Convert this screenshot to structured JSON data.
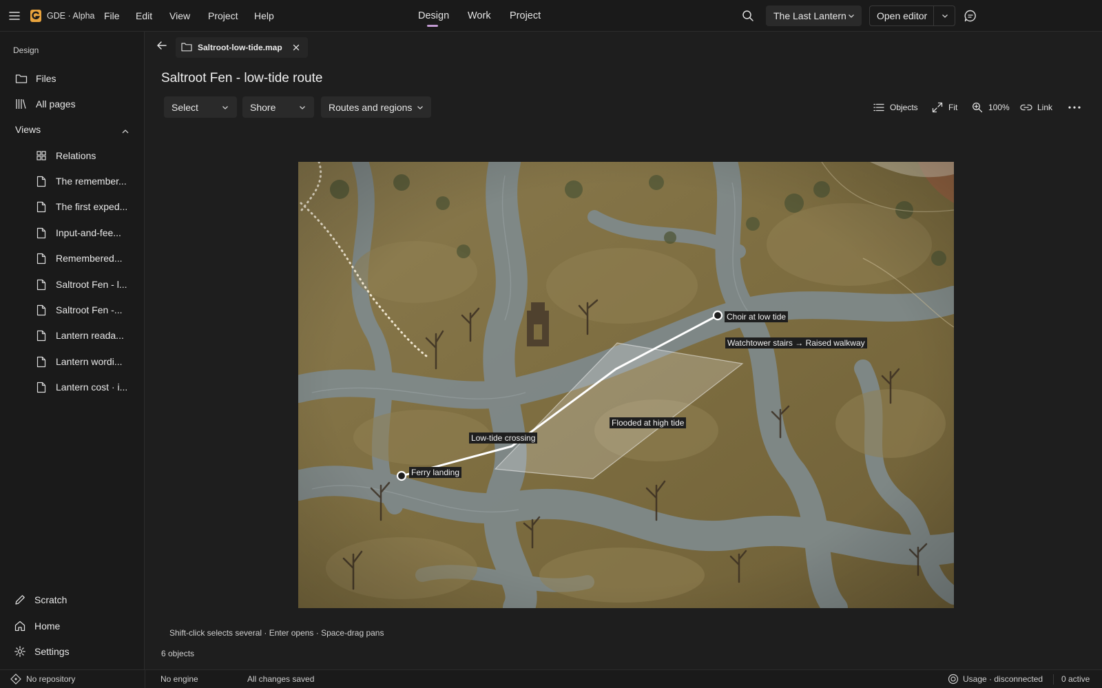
{
  "app": {
    "name": "GDE · Alpha"
  },
  "menu": [
    "File",
    "Edit",
    "View",
    "Project",
    "Help"
  ],
  "nav_tabs": [
    {
      "label": "Design",
      "active": true
    },
    {
      "label": "Work",
      "active": false
    },
    {
      "label": "Project",
      "active": false
    }
  ],
  "header": {
    "project_selector": "The Last Lantern",
    "open_editor_label": "Open editor"
  },
  "sidebar": {
    "section_title": "Design",
    "top_items": [
      {
        "label": "Files",
        "icon": "folder-icon"
      },
      {
        "label": "All pages",
        "icon": "library-icon"
      }
    ],
    "views": {
      "label": "Views",
      "expanded": true,
      "items": [
        {
          "label": "Relations",
          "icon": "grid-icon"
        },
        {
          "label": "The remember...",
          "icon": "page-icon"
        },
        {
          "label": "The first exped...",
          "icon": "page-icon"
        },
        {
          "label": "Input-and-fee...",
          "icon": "page-icon"
        },
        {
          "label": "Remembered...",
          "icon": "page-icon"
        },
        {
          "label": "Saltroot Fen - l...",
          "icon": "page-icon"
        },
        {
          "label": "Saltroot Fen -...",
          "icon": "page-icon"
        },
        {
          "label": "Lantern reada...",
          "icon": "page-icon"
        },
        {
          "label": "Lantern wordi...",
          "icon": "page-icon"
        },
        {
          "label": "Lantern cost · i...",
          "icon": "page-icon"
        }
      ]
    },
    "bottom_items": [
      {
        "label": "Scratch",
        "icon": "pencil-icon"
      },
      {
        "label": "Home",
        "icon": "home-icon"
      },
      {
        "label": "Settings",
        "icon": "gear-icon"
      }
    ]
  },
  "document": {
    "file_tab": "Saltroot-low-tide.map",
    "title": "Saltroot Fen - low-tide route",
    "dropdowns": [
      "Select",
      "Shore",
      "Routes and regions"
    ],
    "tools": [
      {
        "label": "Objects",
        "icon": "list-icon"
      },
      {
        "label": "Fit",
        "icon": "expand-icon"
      },
      {
        "label": "100%",
        "icon": "zoom-icon"
      },
      {
        "label": "Link",
        "icon": "link-icon"
      }
    ],
    "map_labels": {
      "choir": "Choir at low tide",
      "watchtower": "Watchtower stairs → Raised walkway",
      "flooded": "Flooded at high tide",
      "crossing": "Low-tide crossing",
      "ferry": "Ferry landing"
    },
    "hint": "Shift-click selects several · Enter opens · Space-drag pans",
    "object_count": "6 objects"
  },
  "status": {
    "repository": "No repository",
    "engine": "No engine",
    "saved": "All changes saved",
    "usage": "Usage · disconnected",
    "active": "0 active"
  },
  "colors": {
    "accent": "#c39bd3",
    "logo": "#e8a33d",
    "background": "#1e1e1e",
    "panel": "#1a1a1a"
  }
}
